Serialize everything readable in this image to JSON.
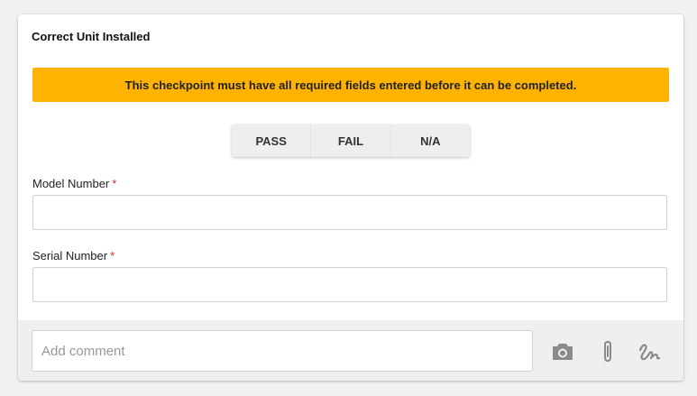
{
  "checkpoint": {
    "title": "Correct Unit Installed",
    "warning": "This checkpoint must have all required fields entered before it can be completed.",
    "warning_color": "#ffb300",
    "options": [
      "PASS",
      "FAIL",
      "N/A"
    ],
    "fields": [
      {
        "label": "Model Number",
        "required_mark": "*",
        "value": ""
      },
      {
        "label": "Serial Number",
        "required_mark": "*",
        "value": ""
      }
    ]
  },
  "footer": {
    "comment_placeholder": "Add comment",
    "icons": [
      "camera-icon",
      "paperclip-icon",
      "signature-icon"
    ]
  }
}
